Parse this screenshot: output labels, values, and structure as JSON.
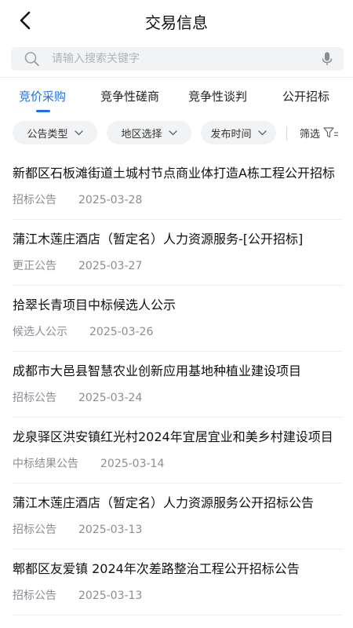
{
  "header": {
    "title": "交易信息"
  },
  "search": {
    "placeholder": "请输入搜索关键字",
    "value": ""
  },
  "tabs": [
    {
      "label": "竞价采购",
      "active": true
    },
    {
      "label": "竞争性磋商",
      "active": false
    },
    {
      "label": "竞争性谈判",
      "active": false
    },
    {
      "label": "公开招标",
      "active": false
    }
  ],
  "filters": {
    "chips": [
      {
        "label": "公告类型"
      },
      {
        "label": "地区选择"
      },
      {
        "label": "发布时间"
      }
    ],
    "screen_label": "筛选"
  },
  "items": [
    {
      "title": "新都区石板滩街道土城村节点商业体打造A栋工程公开招标",
      "type": "招标公告",
      "date": "2025-03-28"
    },
    {
      "title": "蒲江木莲庄酒店（暂定名）人力资源服务-[公开招标]",
      "type": "更正公告",
      "date": "2025-03-27"
    },
    {
      "title": "拾翠长青项目中标候选人公示",
      "type": "候选人公示",
      "date": "2025-03-26"
    },
    {
      "title": "成都市大邑县智慧农业创新应用基地种植业建设项目",
      "type": "招标公告",
      "date": "2025-03-24"
    },
    {
      "title": "龙泉驿区洪安镇红光村2024年宜居宜业和美乡村建设项目",
      "type": "中标结果公告",
      "date": "2025-03-14"
    },
    {
      "title": "蒲江木莲庄酒店（暂定名）人力资源服务公开招标公告",
      "type": "招标公告",
      "date": "2025-03-13"
    },
    {
      "title": "郫都区友爱镇 2024年次差路整治工程公开招标公告",
      "type": "招标公告",
      "date": "2025-03-13"
    }
  ],
  "colors": {
    "accent": "#1f6fe0",
    "chip_bg": "#f2f3f5",
    "meta": "#8a8d93"
  },
  "icons": {
    "back": "chevron-left-icon",
    "search": "search-icon",
    "mic": "microphone-icon",
    "filter": "funnel-icon",
    "chip": "chevron-down-icon"
  }
}
